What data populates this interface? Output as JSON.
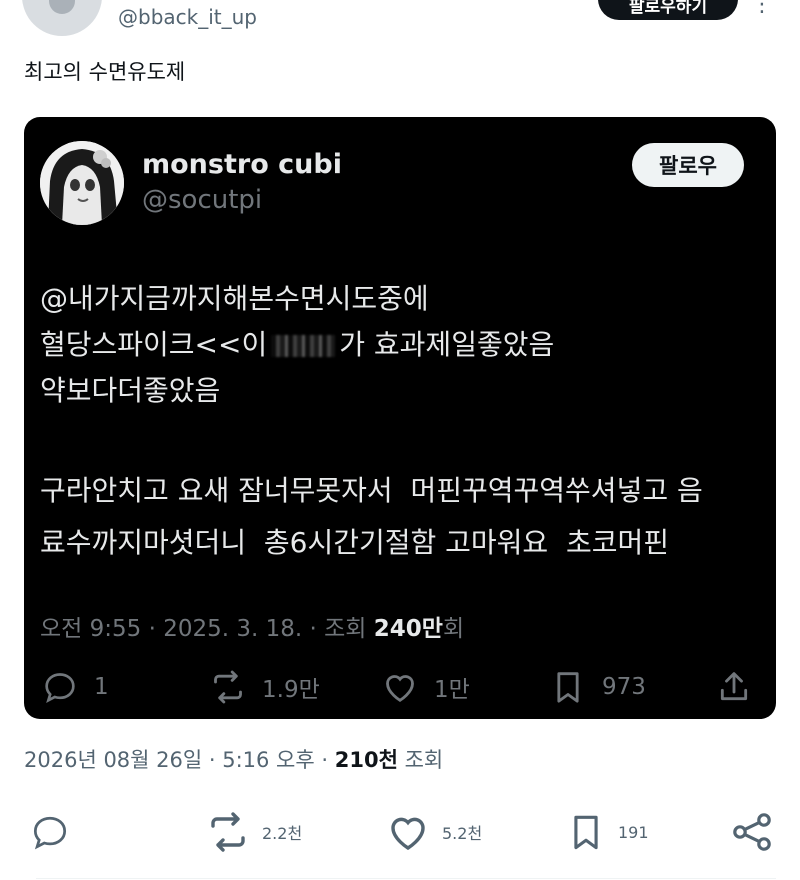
{
  "outer_post": {
    "handle": "@bback_it_up",
    "follow_label": "팔로우하기",
    "text": "최고의 수면유도제",
    "meta": {
      "time": "2026년 08월 26일 · 5:16 오후 · ",
      "views_count": "210천",
      "views_label": " 조회"
    },
    "actions": {
      "reply": "",
      "repost": "2.2천",
      "like": "5.2천",
      "bookmark": "191"
    }
  },
  "embedded_post": {
    "name": "monstro cubi",
    "handle": "@socutpi",
    "follow_label": "팔로우",
    "lines": {
      "line1": "@내가지금까지해본수면시도중에",
      "line2_a": "혈당스파이크<<이",
      "line2_b": "가 효과제일좋았음",
      "line3": "약보다더좋았음",
      "line4": "구라안치고 요새 잠너무못자서  머핀꾸역꾸역쑤셔넣고 음",
      "line5": "료수까지마셧더니  총6시간기절함 고마워요  초코머핀"
    },
    "meta": {
      "time": "오전 9:55 · 2025. 3. 18. · 조회 ",
      "views_count": "240만",
      "views_label": "회"
    },
    "actions": {
      "reply": "1",
      "repost": "1.9만",
      "like": "1만",
      "bookmark": "973"
    }
  }
}
